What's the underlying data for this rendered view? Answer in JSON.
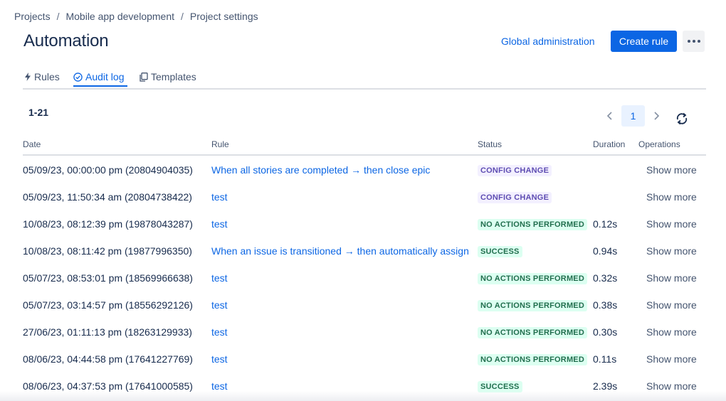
{
  "breadcrumb": [
    "Projects",
    "Mobile app development",
    "Project settings"
  ],
  "breadcrumb_separator": "/",
  "page_title": "Automation",
  "header": {
    "global_admin_label": "Global administration",
    "create_rule_label": "Create rule",
    "more_icon": "more-horizontal-icon"
  },
  "tabs": [
    {
      "label": "Rules",
      "icon": "lightning-icon",
      "active": false
    },
    {
      "label": "Audit log",
      "icon": "check-circle-icon",
      "active": true
    },
    {
      "label": "Templates",
      "icon": "copy-icon",
      "active": false
    }
  ],
  "range_label": "1-21",
  "pagination": {
    "current_page": "1",
    "prev_icon": "chevron-left-icon",
    "next_icon": "chevron-right-icon",
    "refresh_icon": "refresh-icon"
  },
  "columns": {
    "date": "Date",
    "rule": "Rule",
    "status": "Status",
    "duration": "Duration",
    "operations": "Operations"
  },
  "rows": [
    {
      "date": "05/09/23, 00:00:00 pm (20804904035)",
      "rule": "When all stories are completed → then close epic",
      "status": "CONFIG CHANGE",
      "status_type": "config",
      "duration": "",
      "operation": "Show more"
    },
    {
      "date": "05/09/23, 11:50:34 am (20804738422)",
      "rule": "test",
      "status": "CONFIG CHANGE",
      "status_type": "config",
      "duration": "",
      "operation": "Show more"
    },
    {
      "date": "10/08/23, 08:12:39 pm (19878043287)",
      "rule": "test",
      "status": "NO ACTIONS PERFORMED",
      "status_type": "noact",
      "duration": "0.12s",
      "operation": "Show more"
    },
    {
      "date": "10/08/23, 08:11:42 pm (19877996350)",
      "rule": "When an issue is transitioned → then automatically assign",
      "status": "SUCCESS",
      "status_type": "success",
      "duration": "0.94s",
      "operation": "Show more"
    },
    {
      "date": "05/07/23, 08:53:01 pm (18569966638)",
      "rule": "test",
      "status": "NO ACTIONS PERFORMED",
      "status_type": "noact",
      "duration": "0.32s",
      "operation": "Show more"
    },
    {
      "date": "05/07/23, 03:14:57 pm (18556292126)",
      "rule": "test",
      "status": "NO ACTIONS PERFORMED",
      "status_type": "noact",
      "duration": "0.38s",
      "operation": "Show more"
    },
    {
      "date": "27/06/23, 01:11:13 pm (18263129933)",
      "rule": "test",
      "status": "NO ACTIONS PERFORMED",
      "status_type": "noact",
      "duration": "0.30s",
      "operation": "Show more"
    },
    {
      "date": "08/06/23, 04:44:58 pm (17641227769)",
      "rule": "test",
      "status": "NO ACTIONS PERFORMED",
      "status_type": "noact",
      "duration": "0.11s",
      "operation": "Show more"
    },
    {
      "date": "08/06/23, 04:37:53 pm (17641000585)",
      "rule": "test",
      "status": "SUCCESS",
      "status_type": "success",
      "duration": "2.39s",
      "operation": "Show more"
    }
  ],
  "colors": {
    "accent": "#0c66e4",
    "config_badge_bg": "#f3f0ff",
    "config_badge_fg": "#5e4db2",
    "success_badge_bg": "#dcfff1",
    "success_badge_fg": "#216e4e"
  }
}
